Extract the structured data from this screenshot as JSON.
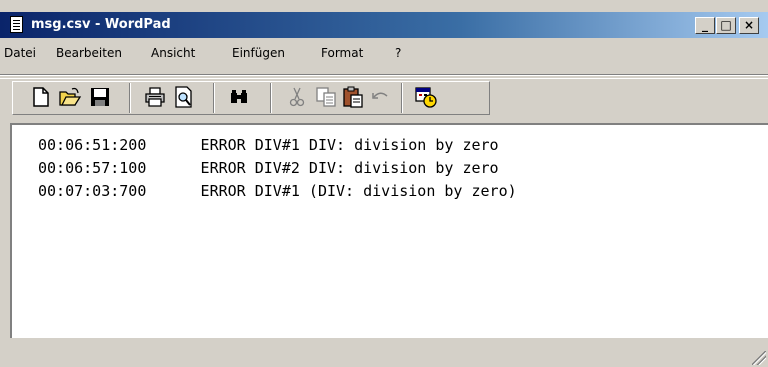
{
  "window": {
    "title": "msg.csv - WordPad",
    "controls": {
      "minimize": "_",
      "maximize": "□",
      "close": "×"
    }
  },
  "menu": {
    "items": [
      "Datei",
      "Bearbeiten",
      "Ansicht",
      "Einfügen",
      "Format",
      "?"
    ]
  },
  "toolbar": {
    "buttons": [
      {
        "name": "new-document-icon",
        "enabled": true
      },
      {
        "name": "open-folder-icon",
        "enabled": true
      },
      {
        "name": "save-disk-icon",
        "enabled": true
      },
      {
        "name": "print-icon",
        "enabled": true
      },
      {
        "name": "print-preview-icon",
        "enabled": true
      },
      {
        "name": "find-binoculars-icon",
        "enabled": true
      },
      {
        "name": "cut-scissors-icon",
        "enabled": false
      },
      {
        "name": "copy-icon",
        "enabled": false
      },
      {
        "name": "paste-icon",
        "enabled": true
      },
      {
        "name": "undo-icon",
        "enabled": false
      },
      {
        "name": "insert-date-time-icon",
        "enabled": true
      }
    ]
  },
  "document": {
    "lines": [
      "00:06:51:200      ERROR DIV#1 DIV: division by zero",
      "00:06:57:100      ERROR DIV#2 DIV: division by zero",
      "00:07:03:700      ERROR DIV#1 (DIV: division by zero)"
    ]
  },
  "statusbar": {
    "text": ""
  }
}
